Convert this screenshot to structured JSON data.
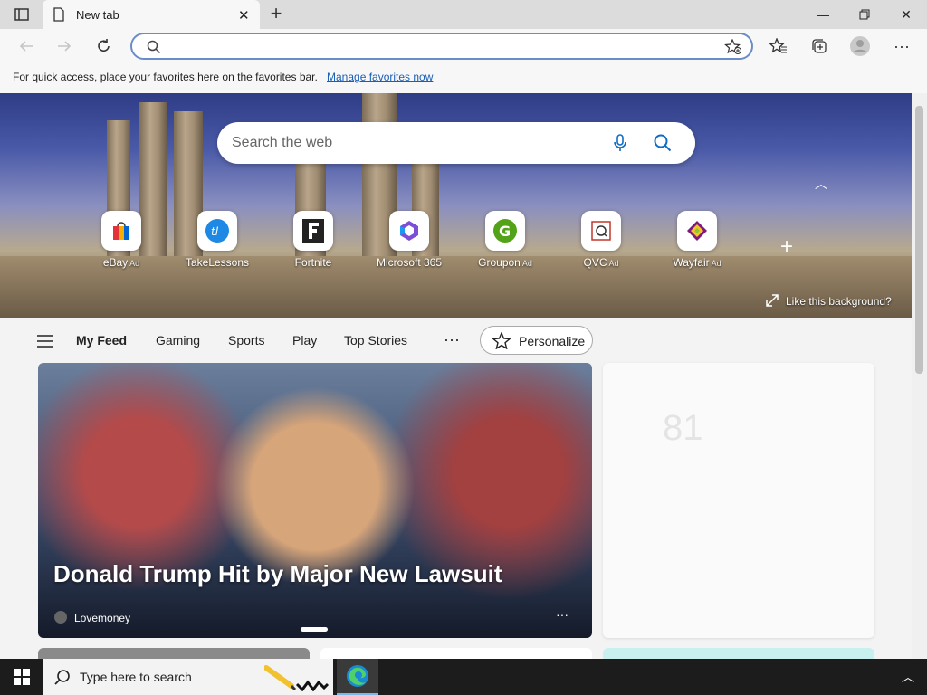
{
  "browser": {
    "tab_title": "New tab",
    "address_placeholder": "",
    "favorites_message": "For quick access, place your favorites here on the favorites bar.",
    "favorites_link": "Manage favorites now"
  },
  "hero": {
    "search_placeholder": "Search the web",
    "quick_links": [
      {
        "label": "eBay",
        "ad": "Ad",
        "color": "#e53238"
      },
      {
        "label": "TakeLessons",
        "ad": "",
        "color": "#1e88e5"
      },
      {
        "label": "Fortnite",
        "ad": "",
        "color": "#222222"
      },
      {
        "label": "Microsoft 365",
        "ad": "",
        "color": "#7b4fd6"
      },
      {
        "label": "Groupon",
        "ad": "Ad",
        "color": "#53a318"
      },
      {
        "label": "QVC",
        "ad": "Ad",
        "color": "#c0392b"
      },
      {
        "label": "Wayfair",
        "ad": "Ad",
        "color": "#7f187f"
      }
    ],
    "like_background": "Like this background?"
  },
  "feed": {
    "tabs": [
      "My Feed",
      "Gaming",
      "Sports",
      "Play",
      "Top Stories"
    ],
    "personalize": "Personalize",
    "headline": "Donald Trump Hit by Major New Lawsuit",
    "source": "Lovemoney"
  },
  "weather": {
    "temp": "81"
  },
  "taskbar": {
    "search_placeholder": "Type here to search"
  }
}
